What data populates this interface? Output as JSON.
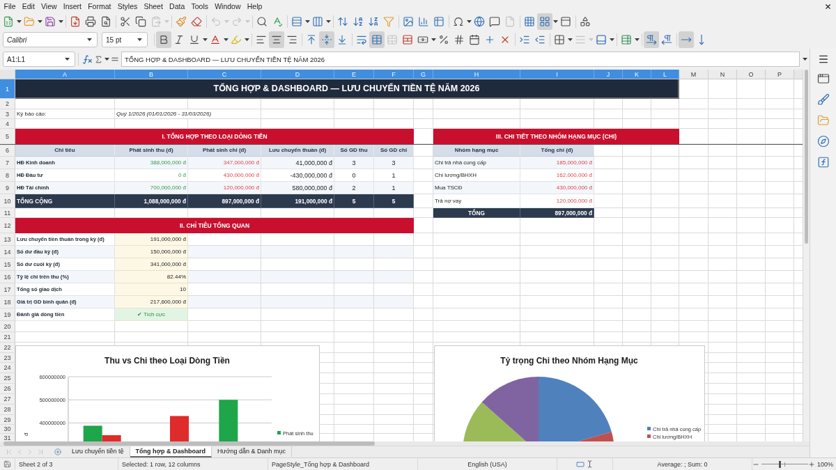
{
  "menu_bar": [
    "File",
    "Edit",
    "View",
    "Insert",
    "Format",
    "Styles",
    "Sheet",
    "Data",
    "Tools",
    "Window",
    "Help"
  ],
  "standard_toolbar": {
    "paste_disabled": true,
    "undo_disabled": true,
    "redo_disabled": true,
    "header_footer_disabled": true,
    "freeze_on": true
  },
  "formatting_toolbar": {
    "font_name": "Calibri",
    "font_size": "15 pt",
    "bold": true,
    "italic": false,
    "underline": false,
    "align_left": false,
    "align_center": true,
    "align_right": false,
    "align_top": false,
    "align_middle": true,
    "align_bottom": false,
    "wrap_text": false,
    "merge_center": true,
    "merge_cells_disabled": true,
    "border_style_disabled": true,
    "left_to_right": true,
    "right_to_left": false,
    "horizontal_text": true,
    "vertical_text": false
  },
  "formula_bar": {
    "name_box": "A1:L1",
    "formula": "TỔNG HỢP & DASHBOARD — LƯU CHUYỂN TIỀN TỆ NĂM 2026"
  },
  "sheet": {
    "columns": [
      {
        "label": "A",
        "selected": true
      },
      {
        "label": "B",
        "selected": true
      },
      {
        "label": "C",
        "selected": true
      },
      {
        "label": "D",
        "selected": true
      },
      {
        "label": "E",
        "selected": true
      },
      {
        "label": "F",
        "selected": true
      },
      {
        "label": "G",
        "selected": true
      },
      {
        "label": "H",
        "selected": true
      },
      {
        "label": "I",
        "selected": true
      },
      {
        "label": "J",
        "selected": true
      },
      {
        "label": "K",
        "selected": true
      },
      {
        "label": "L",
        "selected": true
      },
      {
        "label": "M",
        "selected": false
      },
      {
        "label": "N",
        "selected": false
      },
      {
        "label": "O",
        "selected": false
      },
      {
        "label": "P",
        "selected": false
      }
    ],
    "rows": [
      {
        "label": "1",
        "selected": true
      },
      {
        "label": "2",
        "selected": false
      },
      {
        "label": "3",
        "selected": false
      },
      {
        "label": "4",
        "selected": false
      },
      {
        "label": "5",
        "selected": false
      },
      {
        "label": "6",
        "selected": false
      },
      {
        "label": "7",
        "selected": false
      },
      {
        "label": "8",
        "selected": false
      },
      {
        "label": "9",
        "selected": false
      },
      {
        "label": "10",
        "selected": false
      },
      {
        "label": "11",
        "selected": false
      },
      {
        "label": "12",
        "selected": false
      },
      {
        "label": "13",
        "selected": false
      },
      {
        "label": "14",
        "selected": false
      },
      {
        "label": "15",
        "selected": false
      },
      {
        "label": "16",
        "selected": false
      },
      {
        "label": "17",
        "selected": false
      },
      {
        "label": "18",
        "selected": false
      },
      {
        "label": "19",
        "selected": false
      },
      {
        "label": "20",
        "selected": false
      },
      {
        "label": "21",
        "selected": false
      },
      {
        "label": "22",
        "selected": false
      },
      {
        "label": "23",
        "selected": false
      },
      {
        "label": "24",
        "selected": false
      },
      {
        "label": "25",
        "selected": false
      },
      {
        "label": "26",
        "selected": false
      },
      {
        "label": "27",
        "selected": false
      },
      {
        "label": "28",
        "selected": false
      },
      {
        "label": "29",
        "selected": false
      },
      {
        "label": "30",
        "selected": false
      },
      {
        "label": "31",
        "selected": false
      }
    ],
    "title": "TỔNG HỢP & DASHBOARD — LƯU CHUYỂN TIỀN TỆ NĂM 2026",
    "period": {
      "label": "Kỳ báo cáo:",
      "value": "Quý 1/2026 (01/01/2026 - 31/03/2026)"
    },
    "cash_flow_summary": {
      "title": "I. TỔNG HỢP THEO LOẠI DÒNG TIỀN",
      "columns": [
        {
          "label": "Chỉ tiêu",
          "kind": "label"
        },
        {
          "label": "Phát sinh thu (đ)",
          "kind": "income"
        },
        {
          "label": "Phát sinh chi (đ)",
          "kind": "expense"
        },
        {
          "label": "Lưu chuyển thuần (đ)",
          "kind": "net"
        },
        {
          "label": "Số GD thu",
          "kind": "count"
        },
        {
          "label": "Số GD chi",
          "kind": "count"
        }
      ],
      "rows": [
        [
          "HĐ Kinh doanh",
          "388,000,000 đ",
          "347,000,000 đ",
          "41,000,000 đ",
          "3",
          "3"
        ],
        [
          "HĐ Đầu tư",
          "0 đ",
          "430,000,000 đ",
          "-430,000,000 đ",
          "0",
          "1"
        ],
        [
          "HĐ Tài chính",
          "700,000,000 đ",
          "120,000,000 đ",
          "580,000,000 đ",
          "2",
          "1"
        ]
      ],
      "total": [
        "TỔNG CỘNG",
        "1,088,000,000 đ",
        "897,000,000 đ",
        "191,000,000 đ",
        "5",
        "5"
      ]
    },
    "overview": {
      "title": "II. CHỈ TIÊU TỔNG QUAN",
      "rows": [
        {
          "label": "Lưu chuyển tiền thuần trong kỳ (đ)",
          "value": "191,000,000 đ",
          "kind": "amount"
        },
        {
          "label": "Số dư đầu kỳ (đ)",
          "value": "150,000,000 đ",
          "kind": "amount"
        },
        {
          "label": "Số dư cuối kỳ (đ)",
          "value": "341,000,000 đ",
          "kind": "amount"
        },
        {
          "label": "Tỷ lệ chi trên thu (%)",
          "value": "82.44%",
          "kind": "amount"
        },
        {
          "label": "Tổng số giao dịch",
          "value": "10",
          "kind": "amount"
        },
        {
          "label": "Giá trị GD bình quân (đ)",
          "value": "217,600,000 đ",
          "kind": "amount"
        },
        {
          "label": "Đánh giá dòng tiền",
          "value": "✔ Tích cực",
          "kind": "status"
        }
      ]
    },
    "expense_detail": {
      "title": "III. CHI TIẾT THEO NHÓM HẠNG MỤC (CHI)",
      "columns": [
        {
          "label": "Nhóm hạng mục",
          "kind": "category"
        },
        {
          "label": "Tổng chi (đ)",
          "kind": "expense"
        }
      ],
      "rows": [
        [
          "Chi trả nhà cung cấp",
          "185,000,000 đ"
        ],
        [
          "Chi lương/BHXH",
          "162,000,000 đ"
        ],
        [
          "Mua TSCĐ",
          "430,000,000 đ"
        ],
        [
          "Trả nợ vay",
          "120,000,000 đ"
        ]
      ],
      "total": [
        "TỔNG",
        "897,000,000 đ"
      ]
    },
    "charts": [
      {
        "chart_data": {
          "type": "bar",
          "title": "Thu vs Chi theo Loại Dòng Tiền",
          "ylabel": "đ",
          "ylim": [
            320000000,
            600000000
          ],
          "yticks": [
            400000000,
            500000000,
            600000000
          ],
          "series": [
            {
              "name": "Phát sinh thu",
              "color": "#1fa54a",
              "values": [
                388000000,
                null,
                500000000
              ]
            },
            {
              "color": "#e02b2b",
              "values": [
                347000000,
                430000000,
                null
              ]
            }
          ]
        }
      },
      {
        "chart_data": {
          "type": "pie",
          "title": "Tỷ trọng Chi theo Nhóm Hạng Mục",
          "values": [
            20.6,
            18.1,
            47.9,
            13.4
          ]
        },
        "legend": [
          {
            "label": "Chi trả nhà cung cấp",
            "color": "#4f81bd"
          },
          {
            "label": "Chi lương/BHXH",
            "color": "#c0504d"
          }
        ]
      }
    ]
  },
  "sheet_tabs": {
    "navigation_disabled": true,
    "tabs": [
      {
        "label": "Lưu chuyển tiền tệ",
        "selected": false
      },
      {
        "label": "Tổng hợp & Dashboard",
        "selected": true
      },
      {
        "label": "Hướng dẫn & Danh mục",
        "selected": false
      }
    ]
  },
  "status_bar": {
    "sheet": "Sheet 2 of 3",
    "selection": "Selected: 1 row, 12 columns",
    "page_style": "PageStyle_Tổng hợp & Dashboard",
    "language": "English (USA)",
    "summary": "Average: ; Sum: 0",
    "zoom_slider": {
      "level": 0.4
    },
    "zoom": "100%"
  }
}
